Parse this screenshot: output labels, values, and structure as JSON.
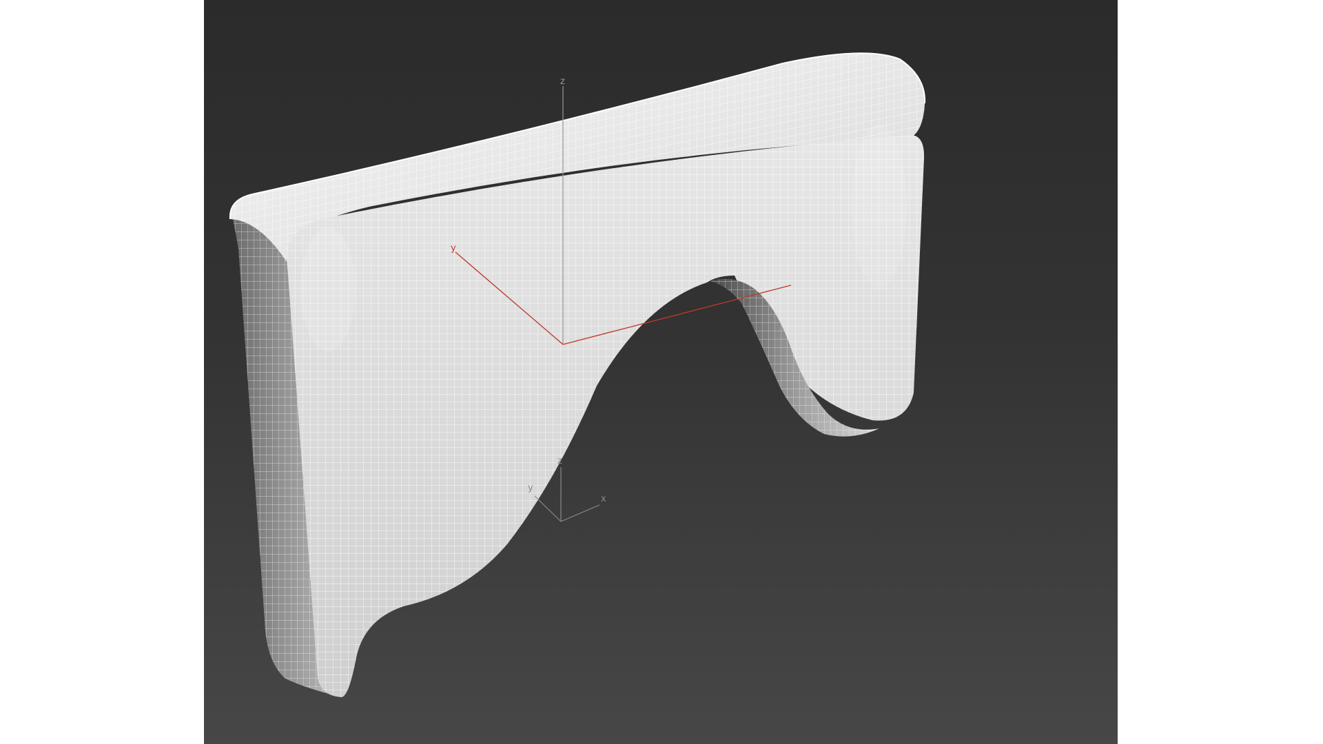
{
  "viewport": {
    "shading_mode": "wireframe-on-shaded",
    "background_gradient": [
      "#2b2b2b",
      "#474747"
    ],
    "mesh_color": "#e8e8e8",
    "wire_color": "#ffffff"
  },
  "object_gizmo": {
    "axes": [
      {
        "label": "z",
        "color": "#9a9a9a"
      },
      {
        "label": "y",
        "color": "#c0392b"
      }
    ]
  },
  "world_tripod": {
    "axes": [
      {
        "label": "z",
        "color": "#8a8a8a"
      },
      {
        "label": "y",
        "color": "#8a8a8a"
      },
      {
        "label": "x",
        "color": "#8a8a8a"
      }
    ]
  },
  "colors": {
    "gizmo_red": "#c0392b",
    "gizmo_gray": "#9a9a9a"
  }
}
